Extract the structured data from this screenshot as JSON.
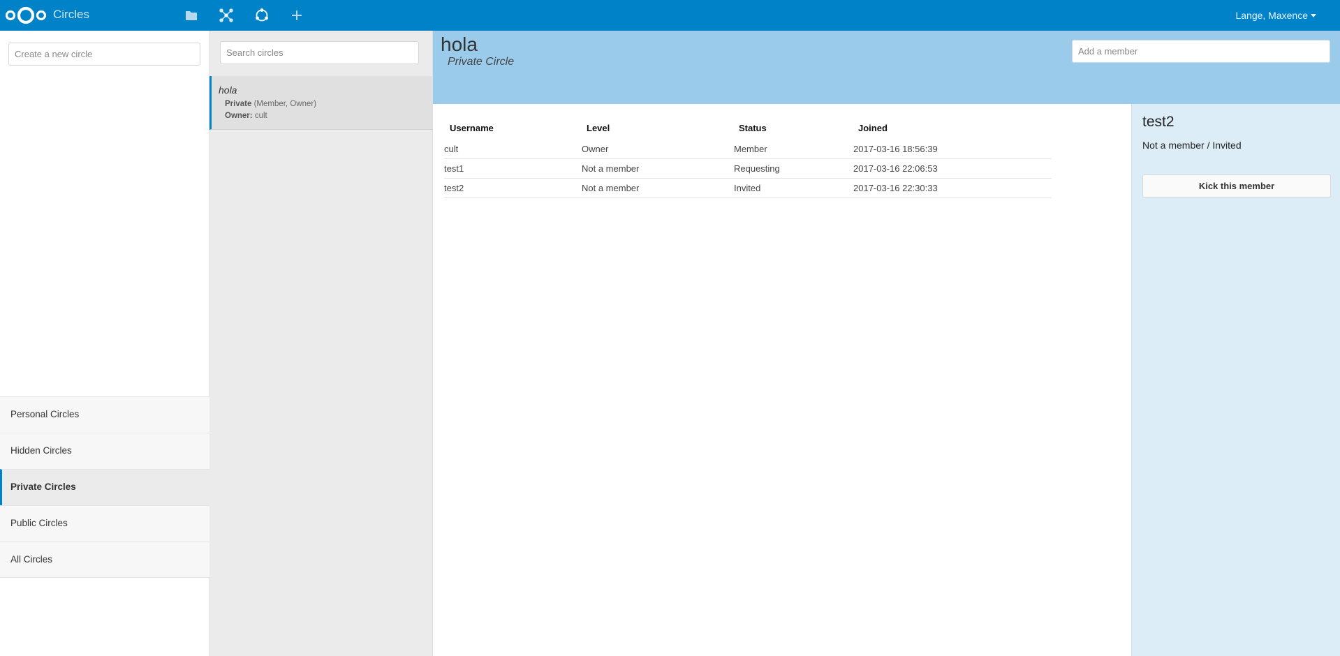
{
  "header": {
    "app_name": "Circles",
    "icons": [
      "files-icon",
      "network-icon",
      "circles-icon",
      "add-icon"
    ],
    "user": "Lange, Maxence",
    "accent_color": "#0082c9"
  },
  "nav": {
    "create_placeholder": "Create a new circle",
    "items": [
      {
        "label": "Personal Circles",
        "active": false
      },
      {
        "label": "Hidden Circles",
        "active": false
      },
      {
        "label": "Private Circles",
        "active": true
      },
      {
        "label": "Public Circles",
        "active": false
      },
      {
        "label": "All Circles",
        "active": false
      }
    ]
  },
  "list": {
    "search_placeholder": "Search circles",
    "circles": [
      {
        "name": "hola",
        "type": "Private",
        "roles": "(Member, Owner)",
        "owner_label": "Owner:",
        "owner": "cult"
      }
    ]
  },
  "main": {
    "title": "hola",
    "subtitle": "Private Circle",
    "add_member_placeholder": "Add a member",
    "columns": [
      "Username",
      "Level",
      "Status",
      "Joined"
    ],
    "members": [
      {
        "username": "cult",
        "level": "Owner",
        "status": "Member",
        "joined": "2017-03-16 18:56:39"
      },
      {
        "username": "test1",
        "level": "Not a member",
        "status": "Requesting",
        "joined": "2017-03-16 22:06:53"
      },
      {
        "username": "test2",
        "level": "Not a member",
        "status": "Invited",
        "joined": "2017-03-16 22:30:33"
      }
    ]
  },
  "detail": {
    "name": "test2",
    "status": "Not a member / Invited",
    "kick_label": "Kick this member"
  }
}
